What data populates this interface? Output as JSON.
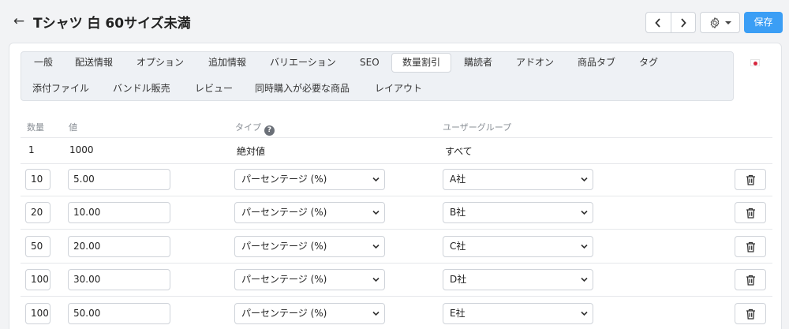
{
  "header": {
    "title": "Tシャツ 白 60サイズ未満",
    "save_label": "保存"
  },
  "icons": {
    "back": "arrow-left-icon",
    "prev": "chevron-left-icon",
    "next": "chevron-right-icon",
    "settings": "gear-icon",
    "language": "japan-flag-icon",
    "help": "question-circle-icon",
    "delete": "trash-icon"
  },
  "tabs": [
    {
      "label": "一般"
    },
    {
      "label": "配送情報"
    },
    {
      "label": "オプション"
    },
    {
      "label": "追加情報"
    },
    {
      "label": "バリエーション"
    },
    {
      "label": "SEO"
    },
    {
      "label": "数量割引",
      "active": true
    },
    {
      "label": "購読者"
    },
    {
      "label": "アドオン"
    },
    {
      "label": "商品タブ"
    },
    {
      "label": "タグ"
    },
    {
      "label": "添付ファイル"
    },
    {
      "label": "バンドル販売"
    },
    {
      "label": "レビュー"
    },
    {
      "label": "同時購入が必要な商品"
    },
    {
      "label": "レイアウト"
    }
  ],
  "table": {
    "columns": {
      "quantity": "数量",
      "value": "値",
      "type": "タイプ",
      "user_group": "ユーザーグループ"
    },
    "base_row": {
      "quantity": "1",
      "value": "1000",
      "type": "絶対値",
      "user_group": "すべて"
    },
    "rows": [
      {
        "quantity": "10",
        "value": "5.00",
        "type": "パーセンテージ (%)",
        "user_group": "A社"
      },
      {
        "quantity": "20",
        "value": "10.00",
        "type": "パーセンテージ (%)",
        "user_group": "B社"
      },
      {
        "quantity": "50",
        "value": "20.00",
        "type": "パーセンテージ (%)",
        "user_group": "C社"
      },
      {
        "quantity": "100",
        "value": "30.00",
        "type": "パーセンテージ (%)",
        "user_group": "D社"
      },
      {
        "quantity": "100",
        "value": "50.00",
        "type": "パーセンテージ (%)",
        "user_group": "E社"
      }
    ]
  },
  "colors": {
    "accent": "#3b9ef5",
    "flag_red": "#d7263d"
  }
}
